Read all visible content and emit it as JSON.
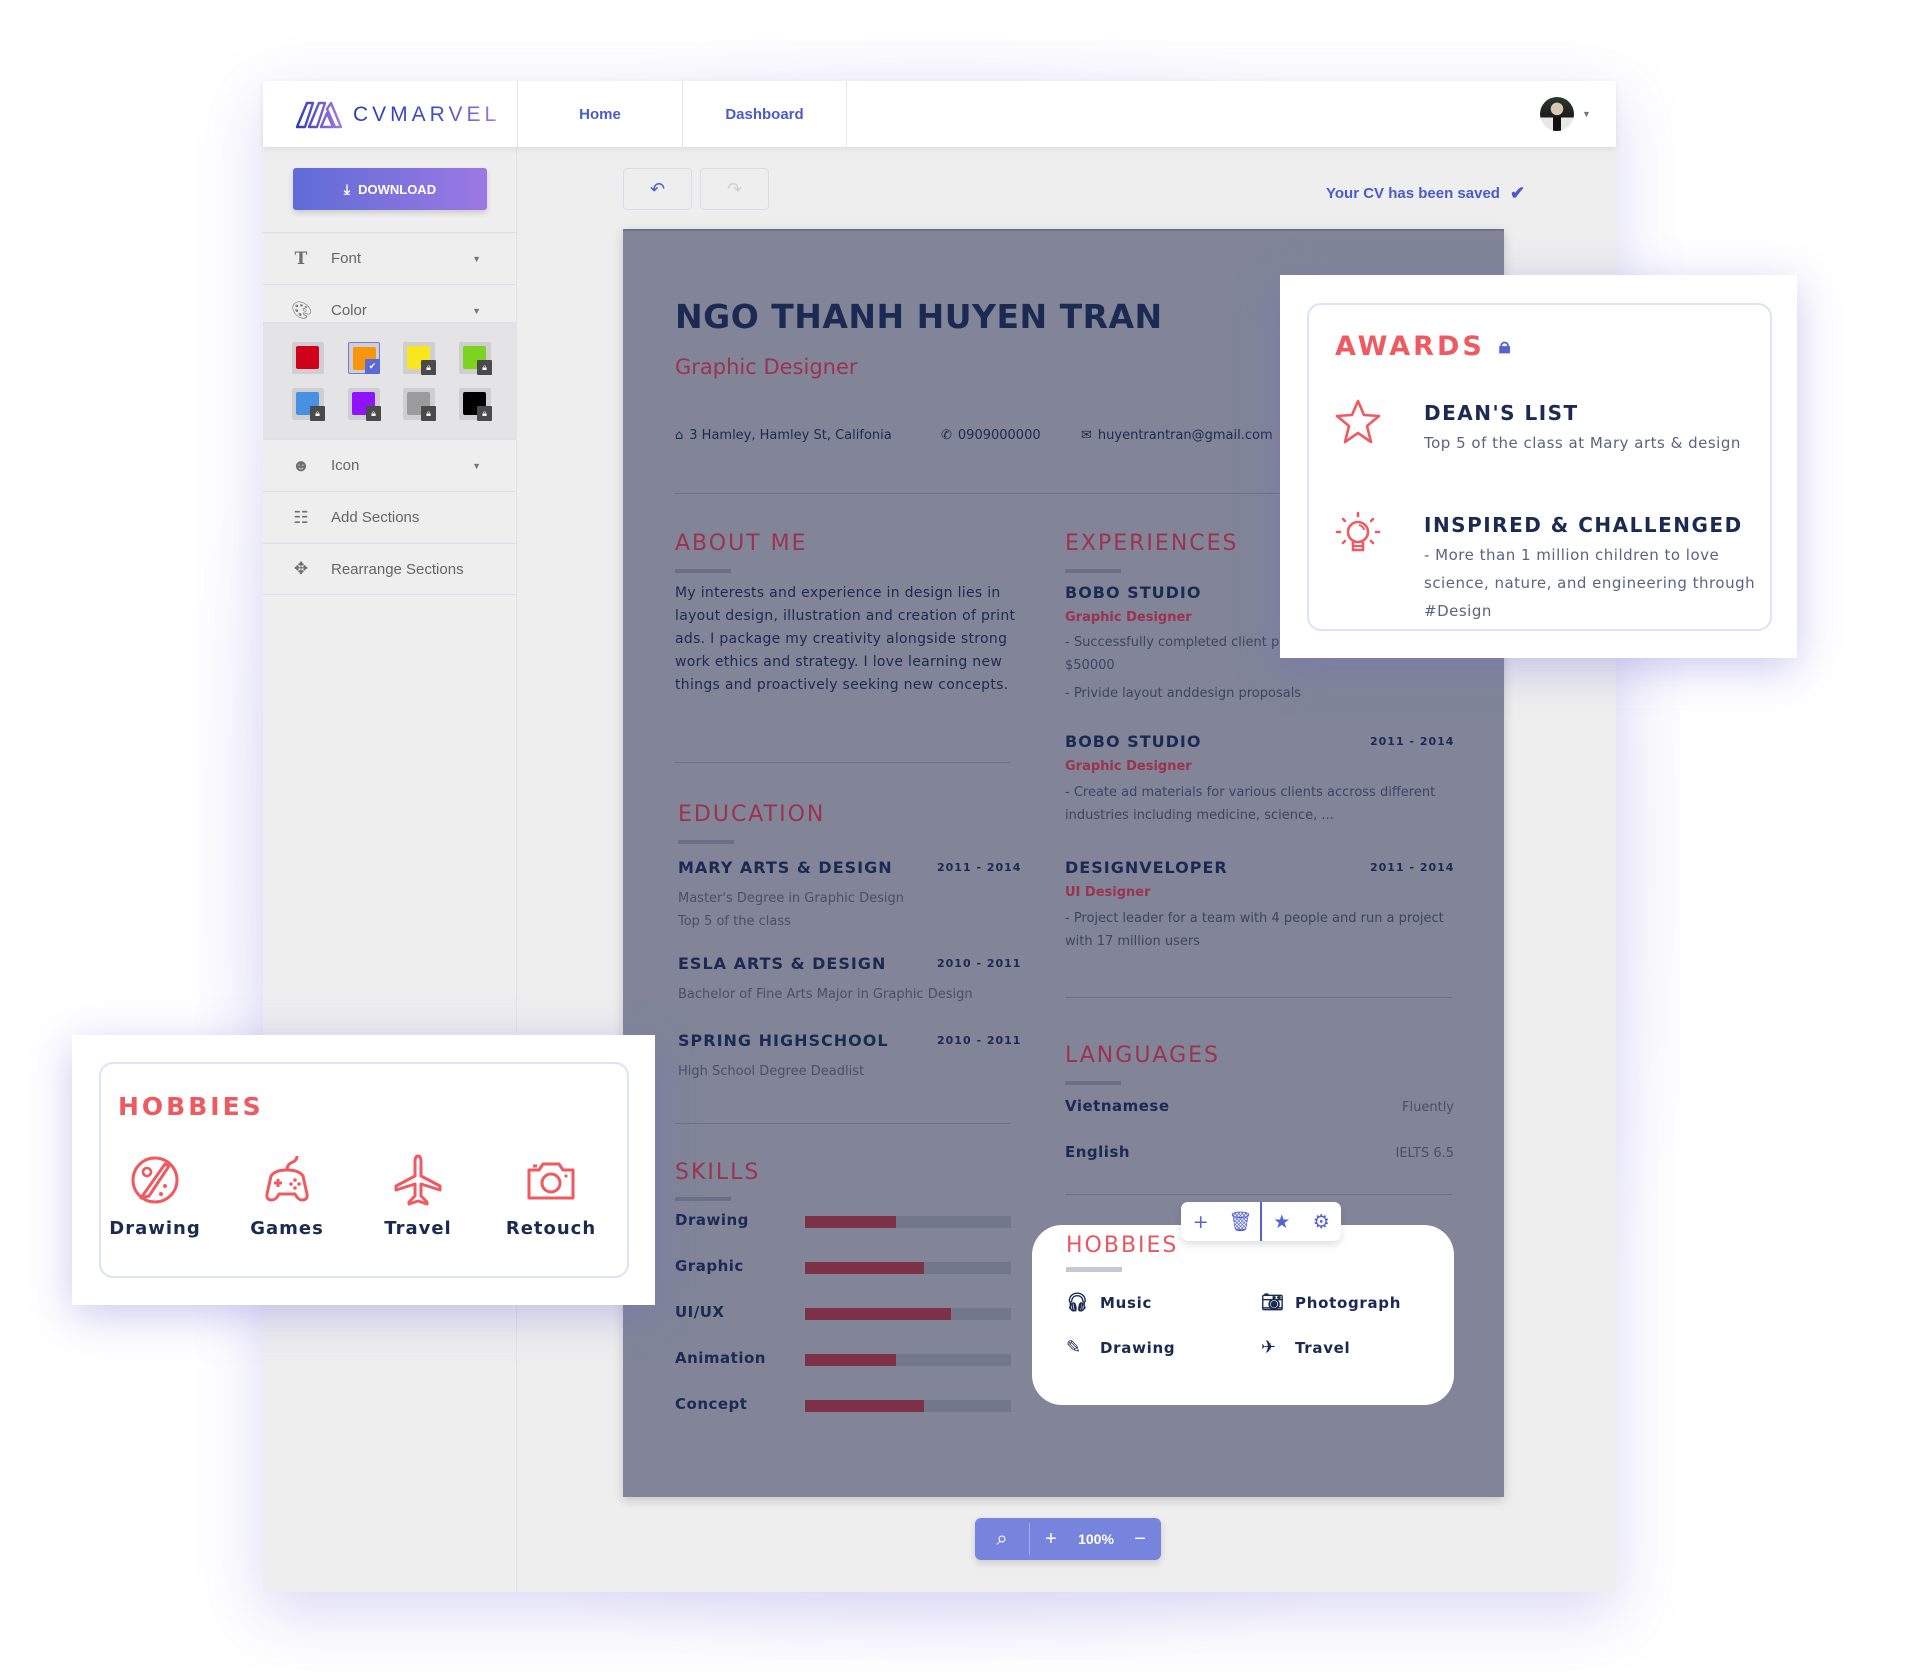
{
  "app": {
    "logo_text": "CVMARVEL",
    "nav": [
      {
        "label": "Home"
      },
      {
        "label": "Dashboard"
      }
    ],
    "saved_status": "Your CV has been saved"
  },
  "sidebar": {
    "download_label": "DOWNLOAD",
    "items": [
      {
        "label": "Font",
        "icon": "text-icon",
        "has_dropdown": true
      },
      {
        "label": "Color",
        "icon": "palette-icon",
        "has_dropdown": true
      },
      {
        "label": "Icon",
        "icon": "smiley-icon",
        "has_dropdown": true
      },
      {
        "label": "Add Sections",
        "icon": "sections-icon",
        "has_dropdown": false
      },
      {
        "label": "Rearrange Sections",
        "icon": "move-icon",
        "has_dropdown": false
      }
    ],
    "colors": [
      {
        "hex": "#d0021b",
        "state": "available"
      },
      {
        "hex": "#f7950c",
        "state": "selected"
      },
      {
        "hex": "#f8e71c",
        "state": "locked"
      },
      {
        "hex": "#7ed321",
        "state": "locked"
      },
      {
        "hex": "#4a90e2",
        "state": "locked"
      },
      {
        "hex": "#9013fe",
        "state": "locked"
      },
      {
        "hex": "#9b9b9b",
        "state": "locked"
      },
      {
        "hex": "#000000",
        "state": "locked"
      }
    ]
  },
  "cv": {
    "name": "NGO THANH HUYEN TRAN",
    "role": "Graphic Designer",
    "contact": {
      "address": "3 Hamley, Hamley St, Califonia",
      "phone": "0909000000",
      "email": "huyentrantran@gmail.com"
    },
    "about": {
      "title": "ABOUT ME",
      "text": "My interests and experience in design lies in layout design, illustration and creation of print ads. I package my creativity alongside strong work ethics and strategy. I love learning new things and proactively seeking new concepts."
    },
    "education": {
      "title": "EDUCATION",
      "items": [
        {
          "school": "MARY ARTS & DESIGN",
          "dates": "2011 - 2014",
          "lines": [
            "Master's Degree in Graphic Design",
            "Top 5 of the class"
          ]
        },
        {
          "school": "ESLA ARTS & DESIGN",
          "dates": "2010 - 2011",
          "lines": [
            "Bachelor of Fine Arts Major in Graphic Design"
          ]
        },
        {
          "school": "SPRING HIGHSCHOOL",
          "dates": "2010 - 2011",
          "lines": [
            "High School Degree Deadlist"
          ]
        }
      ]
    },
    "skills": {
      "title": "SKILLS",
      "items": [
        {
          "name": "Drawing",
          "level": 0.44
        },
        {
          "name": "Graphic",
          "level": 0.58
        },
        {
          "name": "UI/UX",
          "level": 0.71
        },
        {
          "name": "Animation",
          "level": 0.44
        },
        {
          "name": "Concept",
          "level": 0.58
        }
      ]
    },
    "experiences": {
      "title": "EXPERIENCES",
      "items": [
        {
          "company": "BOBO STUDIO",
          "dates": "",
          "role": "Graphic Designer",
          "desc": [
            "- Successfully completed client p",
            "$50000",
            "- Privide layout anddesign proposals"
          ]
        },
        {
          "company": "BOBO STUDIO",
          "dates": "2011 - 2014",
          "role": "Graphic Designer",
          "desc": [
            "- Create ad materials for various clients accross different industries including medicine, science, ..."
          ]
        },
        {
          "company": "DESIGNVELOPER",
          "dates": "2011 - 2014",
          "role": "UI Designer",
          "desc": [
            "- Project leader for a team with 4 people and run a project with 17 million users"
          ]
        }
      ]
    },
    "languages": {
      "title": "LANGUAGES",
      "items": [
        {
          "name": "Vietnamese",
          "level": "Fluently"
        },
        {
          "name": "English",
          "level": "IELTS 6.5"
        }
      ]
    },
    "hobbies": {
      "title": "HOBBIES",
      "items": [
        {
          "label": "Music",
          "icon": "headphones-icon"
        },
        {
          "label": "Photograph",
          "icon": "camera-icon"
        },
        {
          "label": "Drawing",
          "icon": "pencil-icon"
        },
        {
          "label": "Travel",
          "icon": "plane-icon"
        }
      ],
      "toolbar": [
        "add",
        "delete",
        "favorite",
        "settings"
      ]
    }
  },
  "zoom": {
    "value": "100%"
  },
  "awards_card": {
    "title": "AWARDS",
    "items": [
      {
        "title": "DEAN'S LIST",
        "desc": "Top 5 of the class at Mary arts & design",
        "icon": "star-icon"
      },
      {
        "title": "INSPIRED & CHALLENGED",
        "desc": "- More than 1 million children to love science, nature, and engineering through #Design",
        "icon": "lightbulb-icon"
      }
    ]
  },
  "hobbies_card": {
    "title": "HOBBIES",
    "items": [
      {
        "label": "Drawing",
        "icon": "palette-brush-icon"
      },
      {
        "label": "Games",
        "icon": "gamepad-icon"
      },
      {
        "label": "Travel",
        "icon": "airplane-icon"
      },
      {
        "label": "Retouch",
        "icon": "camera-icon"
      }
    ]
  },
  "colors": {
    "accent": "#4a5bc9",
    "cv_background": "#818597",
    "cv_heading_red": "#9b3350",
    "card_red": "#ee5a5f",
    "navy": "#1b2a52"
  }
}
